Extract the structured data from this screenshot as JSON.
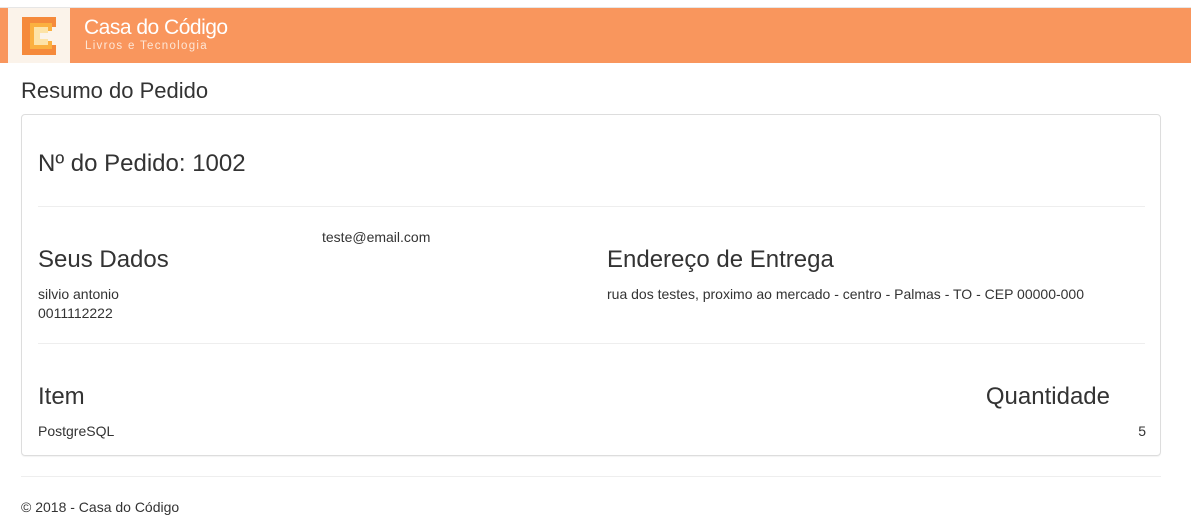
{
  "header": {
    "brand_name": "Casa do Código",
    "brand_tagline": "Livros e Tecnologia",
    "logo_icon": "casa-do-codigo-logo-icon",
    "bar_color": "#f9965d"
  },
  "page": {
    "title": "Resumo do Pedido"
  },
  "order": {
    "number_label": "Nº do Pedido: 1002",
    "customer": {
      "heading": "Seus Dados",
      "email": "teste@email.com",
      "name": "silvio antonio",
      "phone": "0011112222"
    },
    "delivery": {
      "heading": "Endereço de Entrega",
      "address": "rua dos testes, proximo ao mercado - centro - Palmas - TO - CEP 00000-000"
    },
    "items": {
      "item_header": "Item",
      "quantity_header": "Quantidade",
      "rows": [
        {
          "name": "PostgreSQL",
          "quantity": "5"
        }
      ]
    }
  },
  "footer": {
    "text": "© 2018 - Casa do Código"
  }
}
